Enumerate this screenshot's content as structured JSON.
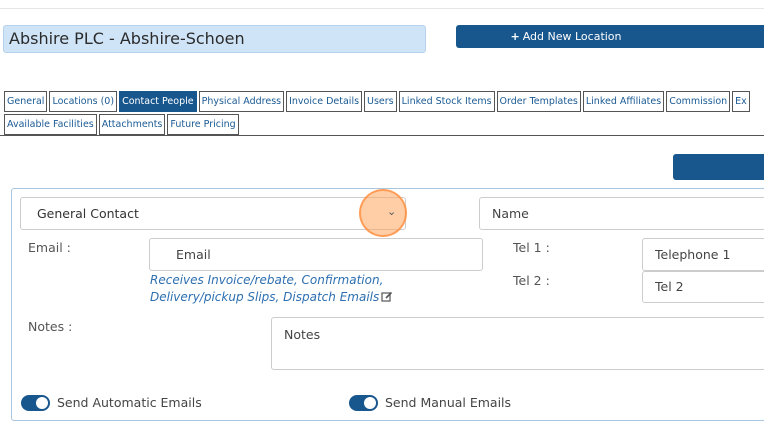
{
  "header": {
    "company_name": "Abshire PLC - Abshire-Schoen",
    "add_location_label": "Add New Location",
    "add_location_icon": "plus-icon"
  },
  "tabs_row1": [
    {
      "label": "General",
      "active": false
    },
    {
      "label": "Locations (0)",
      "active": false
    },
    {
      "label": "Contact People",
      "active": true
    },
    {
      "label": "Physical Address",
      "active": false
    },
    {
      "label": "Invoice Details",
      "active": false
    },
    {
      "label": "Users",
      "active": false
    },
    {
      "label": "Linked Stock Items",
      "active": false
    },
    {
      "label": "Order Templates",
      "active": false
    },
    {
      "label": "Linked Affiliates",
      "active": false
    },
    {
      "label": "Commission",
      "active": false
    },
    {
      "label": "Ex",
      "active": false
    }
  ],
  "tabs_row2": [
    {
      "label": "Available Facilities",
      "active": false
    },
    {
      "label": "Attachments",
      "active": false
    },
    {
      "label": "Future Pricing",
      "active": false
    }
  ],
  "contact_form": {
    "contact_type_selected": "General Contact",
    "name_placeholder": "Name",
    "email_label": "Email :",
    "email_placeholder": "Email",
    "email_help": "Receives Invoice/rebate, Confirmation, Delivery/pickup Slips, Dispatch Emails",
    "tel1_label": "Tel 1 :",
    "tel1_placeholder": "Telephone 1",
    "tel2_label": "Tel 2 :",
    "tel2_placeholder": "Tel 2",
    "notes_label": "Notes :",
    "notes_placeholder": "Notes",
    "send_automatic_label": "Send Automatic Emails",
    "send_automatic_on": true,
    "send_manual_label": "Send Manual Emails",
    "send_manual_on": true
  },
  "colors": {
    "primary": "#18578e",
    "company_box_bg": "#cfe4f7",
    "help_text": "#2d6fb0",
    "focus_ring": "#ffa55f"
  }
}
